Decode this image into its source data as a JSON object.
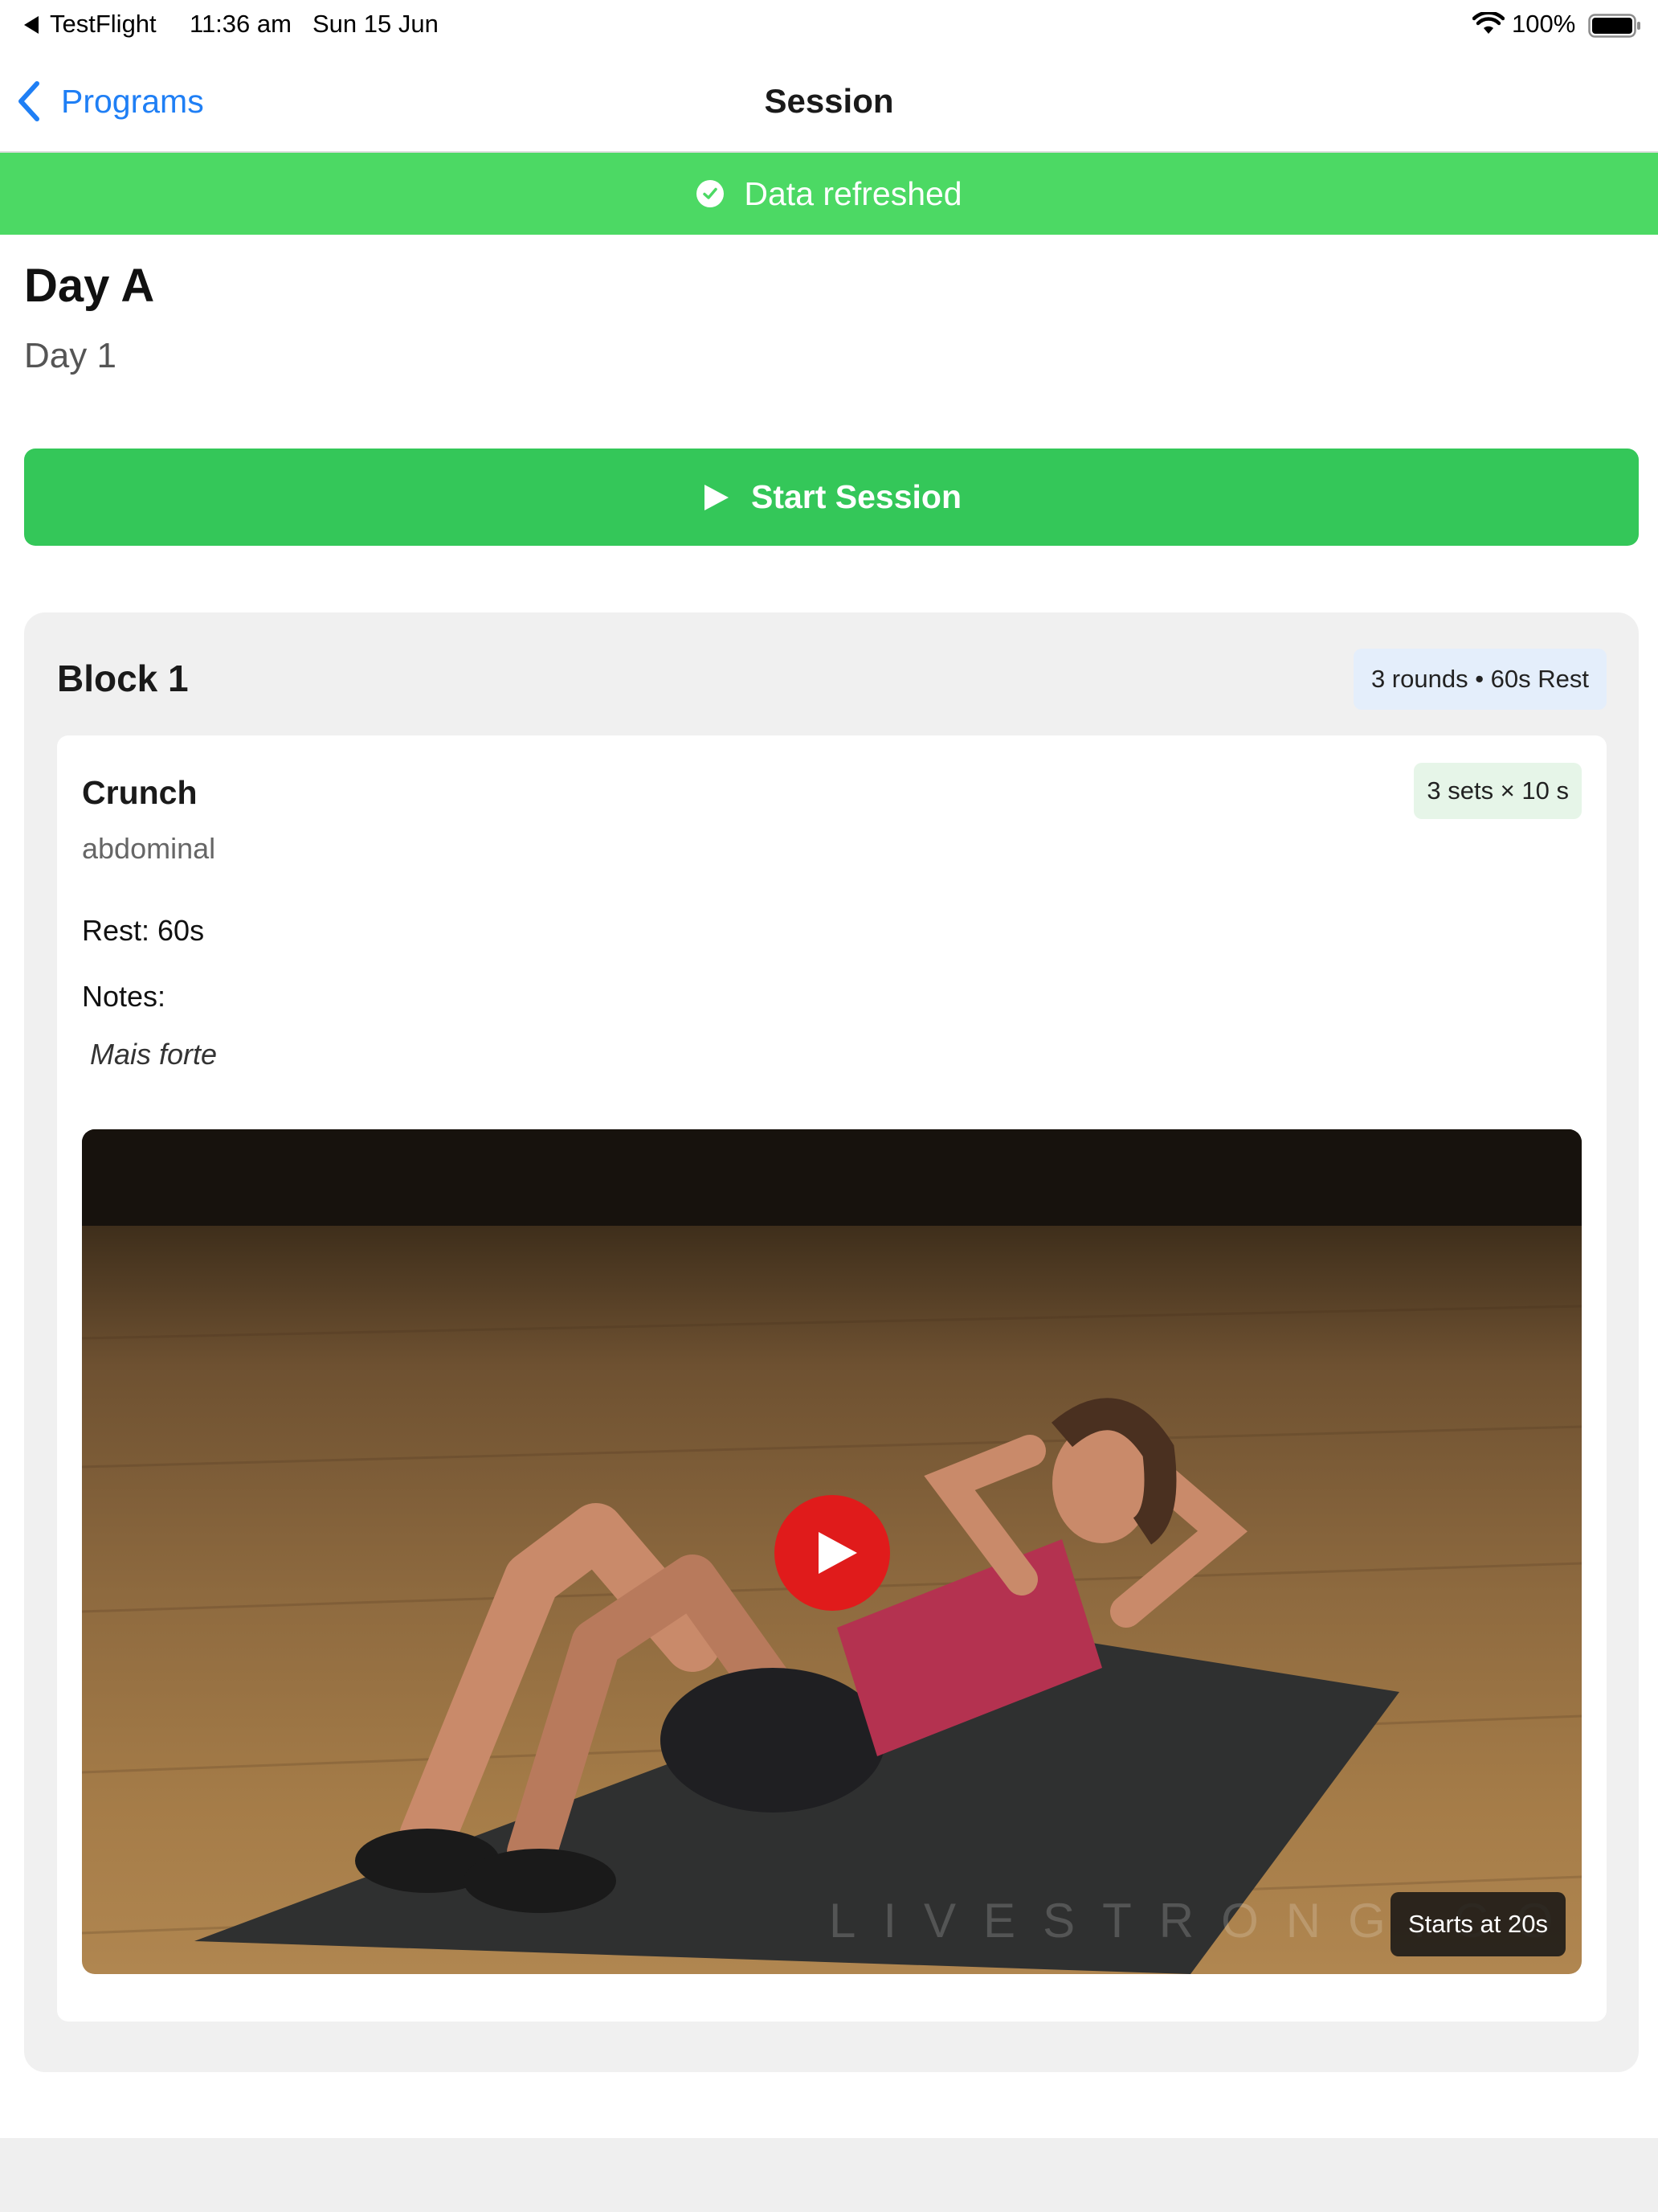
{
  "status_bar": {
    "back_app": "TestFlight",
    "time": "11:36 am",
    "date": "Sun 15 Jun",
    "battery": "100%"
  },
  "nav": {
    "back_label": "Programs",
    "title": "Session"
  },
  "banner": {
    "text": "Data refreshed",
    "color": "#4cd964"
  },
  "session": {
    "title": "Day A",
    "subtitle": "Day 1",
    "start_label": "Start Session",
    "accent": "#34c759"
  },
  "block": {
    "title": "Block 1",
    "badge": "3 rounds • 60s Rest",
    "exercise": {
      "name": "Crunch",
      "badge": "3 sets × 10 s",
      "muscle": "abdominal",
      "rest": "Rest: 60s",
      "notes_label": "Notes:",
      "notes": "Mais forte",
      "video": {
        "watermark": "LIVESTRONG.COM",
        "start_label": "Starts at 20s"
      }
    }
  },
  "icons": {
    "back": "chevron-left-icon",
    "banner": "refresh-check-icon",
    "start": "play-icon",
    "video_play": "play-icon",
    "wifi": "wifi-icon",
    "battery": "battery-icon"
  }
}
